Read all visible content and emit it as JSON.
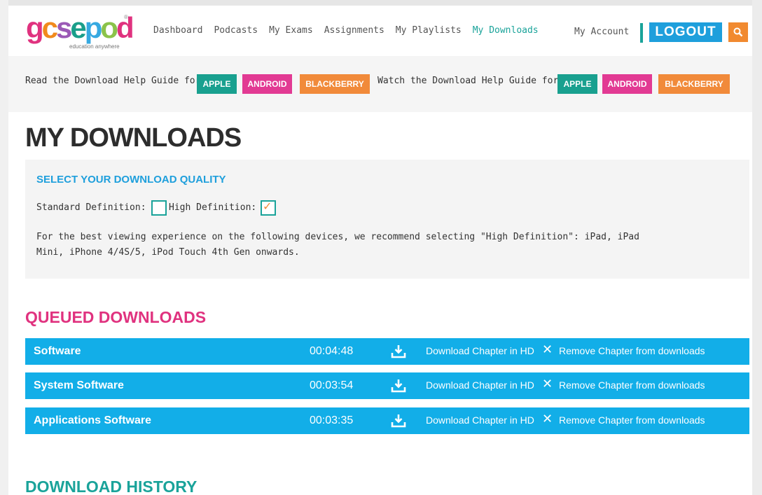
{
  "header": {
    "logo_text": "gcsepod",
    "logo_tagline": "education anywhere",
    "nav": [
      "Dashboard",
      "Podcasts",
      "My Exams",
      "Assignments",
      "My Playlists",
      "My Downloads"
    ],
    "account": "My Account",
    "logout": "LOGOUT",
    "search_icon": "search-icon"
  },
  "help": {
    "read_label": "Read the Download Help Guide for:",
    "watch_label": "Watch the Download Help Guide for:",
    "buttons": [
      "APPLE",
      "ANDROID",
      "BLACKBERRY"
    ]
  },
  "title": "MY DOWNLOADS",
  "quality": {
    "heading": "SELECT YOUR DOWNLOAD QUALITY",
    "standard_label": "Standard Definition:",
    "high_label": "High Definition:",
    "standard_checked": false,
    "high_checked": true,
    "note": "For the best viewing experience on the following devices, we recommend selecting \"High Definition\": iPad, iPad Mini, iPhone 4/4S/5, iPod Touch 4th Gen onwards."
  },
  "queued": {
    "heading": "QUEUED DOWNLOADS",
    "rows": [
      {
        "name": "Software",
        "time": "00:04:48",
        "download": "Download Chapter in HD",
        "remove": "Remove Chapter from downloads"
      },
      {
        "name": "System Software",
        "time": "00:03:54",
        "download": "Download Chapter in HD",
        "remove": "Remove Chapter from downloads"
      },
      {
        "name": "Applications Software",
        "time": "00:03:35",
        "download": "Download Chapter in HD",
        "remove": "Remove Chapter from downloads"
      }
    ]
  },
  "history": {
    "heading": "DOWNLOAD HISTORY"
  },
  "colors": {
    "teal": "#1aa39a",
    "blue": "#1e9fdc",
    "pink": "#e0327f",
    "orange": "#f18a3a",
    "row_blue": "#12aee8"
  }
}
